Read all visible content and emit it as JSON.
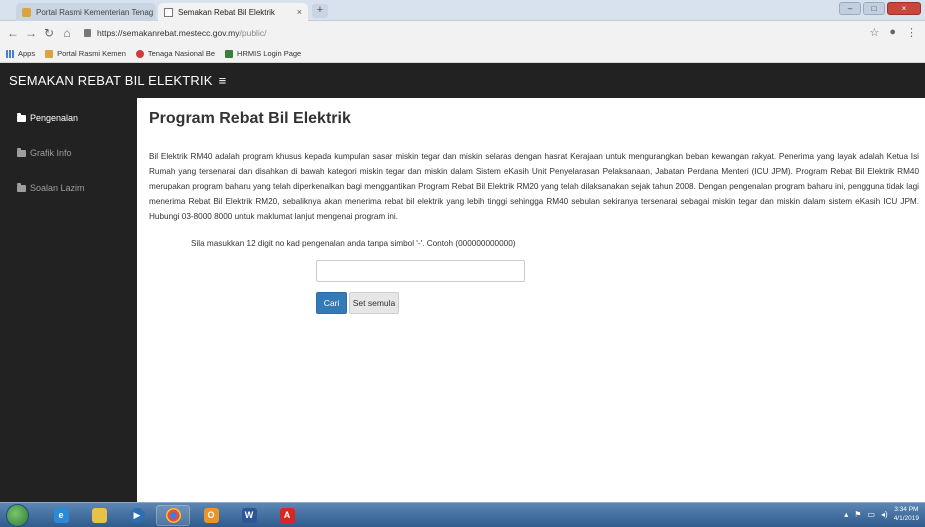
{
  "browser": {
    "tabs": [
      {
        "title": "Portal Rasmi Kementerian Tenag",
        "active": false
      },
      {
        "title": "Semakan Rebat Bil Elektrik",
        "active": true
      }
    ],
    "url_host": "semakanrebat.mestecc.gov.my",
    "url_path": "/public/",
    "url_scheme": "https://",
    "bookmarks": [
      "Apps",
      "Portal Rasmi Kemen",
      "Tenaga Nasional Be",
      "HRMIS Login Page"
    ]
  },
  "app": {
    "title": "SEMAKAN REBAT BIL ELEKTRIK",
    "menu_icon": "≡"
  },
  "sidebar": {
    "items": [
      {
        "label": "Pengenalan",
        "icon": "folder-icon",
        "active": true
      },
      {
        "label": "Grafik Info",
        "icon": "folder-icon",
        "active": false
      },
      {
        "label": "Soalan Lazim",
        "icon": "folder-icon",
        "active": false
      }
    ]
  },
  "main": {
    "title": "Program Rebat Bil Elektrik",
    "description": "Bil Elektrik RM40 adalah program khusus kepada kumpulan sasar miskin tegar dan miskin selaras dengan hasrat Kerajaan untuk mengurangkan beban kewangan rakyat. Penerima yang layak adalah Ketua Isi Rumah yang tersenarai dan disahkan di bawah kategori miskin tegar dan miskin dalam Sistem eKasih Unit Penyelarasan Pelaksanaan, Jabatan Perdana Menteri (ICU JPM). Program Rebat Bil Elektrik RM40 merupakan program baharu yang telah diperkenalkan bagi menggantikan Program Rebat Bil Elektrik RM20 yang telah dilaksanakan sejak tahun 2008. Dengan pengenalan program baharu ini, pengguna tidak lagi menerima Rebat Bil Elektrik RM20, sebaliknya akan menerima rebat bil elektrik yang lebih tinggi sehingga RM40 sebulan sekiranya tersenarai sebagai miskin tegar dan miskin dalam sistem eKasih ICU JPM. Hubungi 03-8000 8000 untuk maklumat lanjut mengenai program ini.",
    "instruction": "Sila masukkan 12 digit no kad pengenalan anda tanpa simbol '-'. Contoh (000000000000)",
    "ic_input_value": "",
    "search_button": "Cari",
    "reset_button": "Set semula"
  },
  "taskbar": {
    "time": "3:34 PM",
    "date": "4/1/2019"
  },
  "colors": {
    "header_bg": "#222222",
    "primary_button": "#337ab7"
  }
}
